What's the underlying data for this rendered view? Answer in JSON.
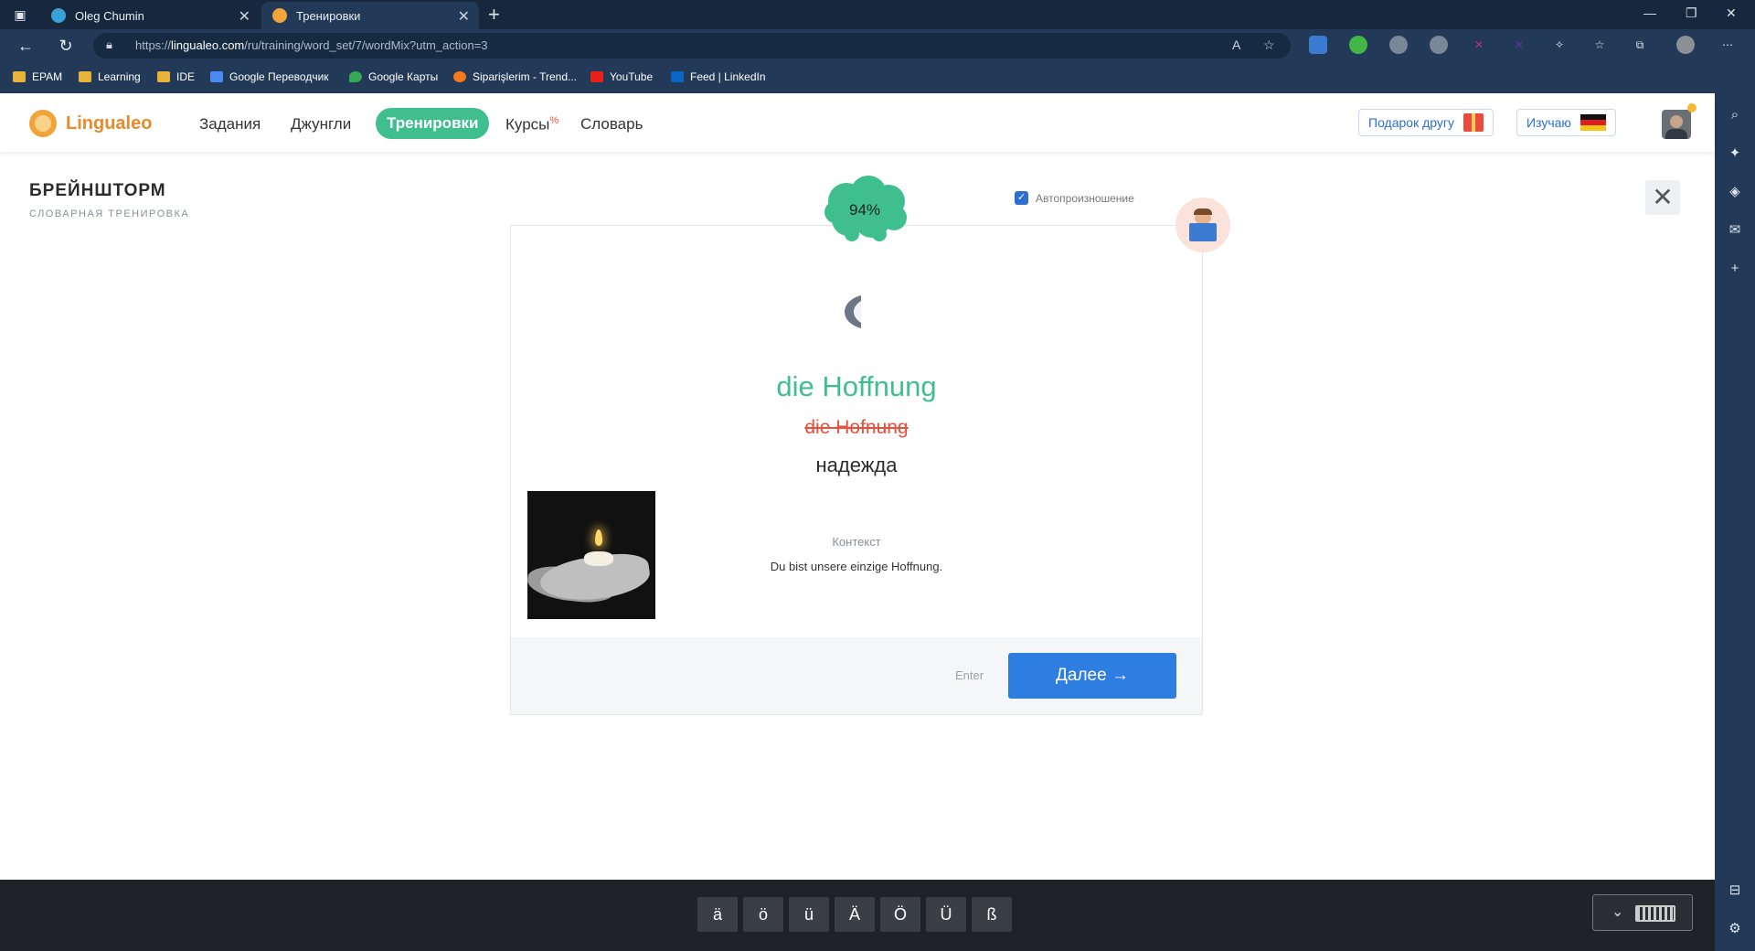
{
  "browser": {
    "tabs": [
      {
        "title": "Oleg Chumin",
        "active": false
      },
      {
        "title": "Тренировки",
        "active": true
      }
    ],
    "url": {
      "prefix": "https://",
      "host": "lingualeo.com",
      "path": "/ru/training/word_set/7/wordMix?utm_action=3"
    },
    "bookmarks": [
      "EPAM",
      "Learning",
      "IDE",
      "Google Переводчик",
      "Google Карты",
      "Siparişlerim - Trend...",
      "YouTube",
      "Feed | LinkedIn"
    ]
  },
  "site": {
    "logo": "Lingualeo",
    "nav": [
      "Задания",
      "Джунгли",
      "Тренировки",
      "Курсы",
      "Словарь"
    ],
    "courses_badge": "%",
    "gift_button": "Подарок другу",
    "learning_button": "Изучаю"
  },
  "training": {
    "title": "БРЕЙНШТОРМ",
    "subtitle": "СЛОВАРНАЯ ТРЕНИРОВКА",
    "progress": "94%",
    "autopronounce_label": "Автопроизношение",
    "autopronounce_checked": true,
    "correct_word": "die Hoffnung",
    "wrong_answer": "die Hofnung",
    "translation": "надежда",
    "context_label": "Контекст",
    "context_text": "Du bist unsere einzige Hoffnung.",
    "enter_hint": "Enter",
    "next_button": "Далее →"
  },
  "keyboard": {
    "keys": [
      "ä",
      "ö",
      "ü",
      "Ä",
      "Ö",
      "Ü",
      "ß"
    ]
  },
  "colors": {
    "accent_green": "#3fbf8d",
    "primary_blue": "#2d7ee0",
    "error_red": "#e9503c",
    "brand_orange": "#e98a2a"
  }
}
